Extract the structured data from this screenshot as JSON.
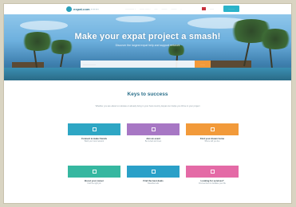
{
  "nav": {
    "logo_text": "expat.com ·······",
    "links": [
      "··········· ·",
      "······ ····· ·",
      "····",
      "·······",
      "·······",
      "·"
    ],
    "login_label": "·····",
    "signup_label": "········"
  },
  "hero": {
    "title": "Make your expat project a smash!",
    "subtitle": "Discover the largest expat help and support network",
    "search_placeholder": "················",
    "search_button": "······"
  },
  "keys": {
    "title": "Keys to success",
    "subtitle": "Whether you are about to relocate or already living in your host country, Expat.com helps you thrive in your project"
  },
  "cards": [
    {
      "title": "Connect & make friends",
      "desc": "Build your local network",
      "color": "#2ea6c4",
      "icon": "people-icon"
    },
    {
      "title": "Join an event",
      "desc": "Be invited and meet",
      "color": "#a777c4",
      "icon": "calendar-icon"
    },
    {
      "title": "Find your dream home",
      "desc": "Where will you live",
      "color": "#f29a3a",
      "icon": "home-icon"
    },
    {
      "title": "Boost your career",
      "desc": "Find the right job",
      "color": "#36b7a0",
      "icon": "briefcase-icon"
    },
    {
      "title": "Find the best deals",
      "desc": "Classified ads",
      "color": "#2aa0c8",
      "icon": "tag-icon"
    },
    {
      "title": "Looking for services?",
      "desc": "Find services to facilitate your life",
      "color": "#e46aa6",
      "icon": "services-icon"
    }
  ]
}
